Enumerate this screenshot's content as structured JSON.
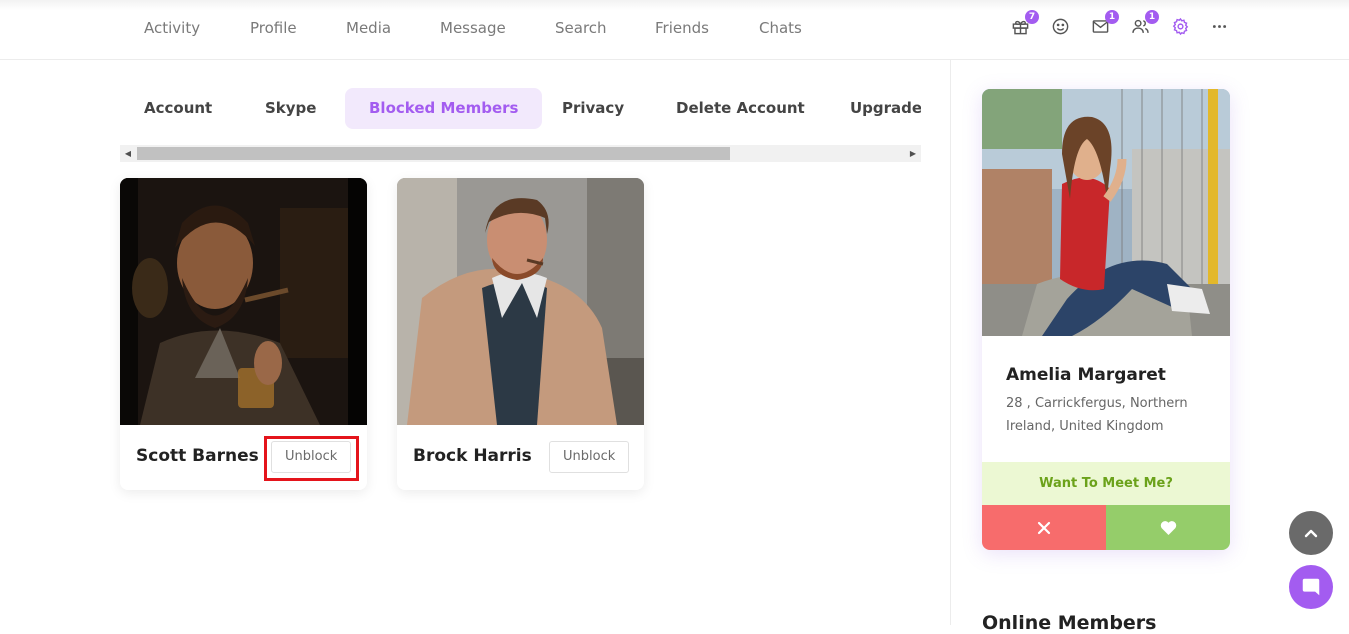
{
  "nav": {
    "links": [
      "Activity",
      "Profile",
      "Media",
      "Message",
      "Search",
      "Friends",
      "Chats"
    ],
    "icons": [
      {
        "name": "gift-icon",
        "badge": "7"
      },
      {
        "name": "smiley-icon",
        "badge": ""
      },
      {
        "name": "mail-icon",
        "badge": "1"
      },
      {
        "name": "friends-icon",
        "badge": "1"
      },
      {
        "name": "settings-icon",
        "badge": ""
      },
      {
        "name": "more-icon",
        "badge": ""
      }
    ],
    "active_icon_color": "#a35cf0"
  },
  "tabs": {
    "items": [
      "Account",
      "Skype",
      "Blocked Members",
      "Privacy",
      "Delete Account",
      "Upgrade Account"
    ],
    "active": "Blocked Members"
  },
  "members": [
    {
      "name": "Scott Barnes",
      "action": "Unblock",
      "highlighted": true
    },
    {
      "name": "Brock Harris",
      "action": "Unblock",
      "highlighted": false
    }
  ],
  "featured": {
    "name": "Amelia Margaret",
    "location": "28 , Carrickfergus, Northern Ireland, United Kingdom",
    "prompt": "Want To Meet Me?",
    "reject_icon": "close-icon",
    "accept_icon": "heart-icon"
  },
  "sidebar": {
    "heading": "Online Members"
  },
  "colors": {
    "accent": "#a35cf0",
    "reject": "#f76c6c",
    "accept": "#95cd6a",
    "meet_bg": "#ecf8d3",
    "highlight": "#e4141b"
  }
}
